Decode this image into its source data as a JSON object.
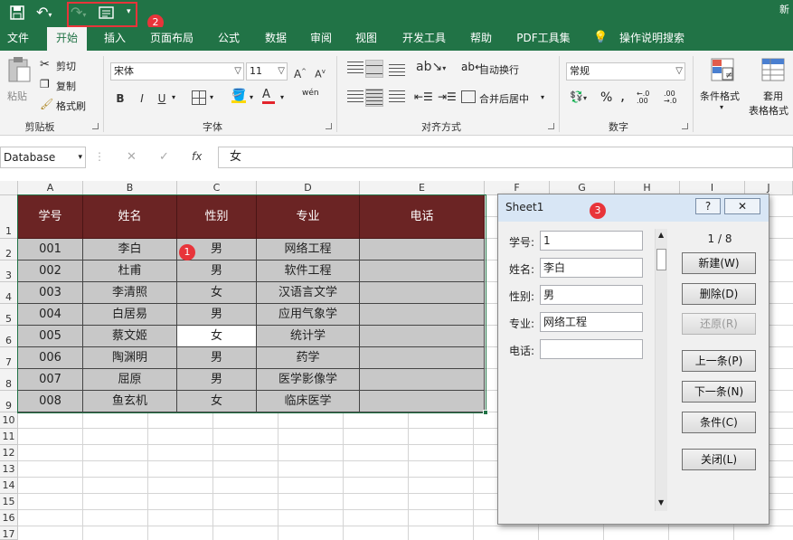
{
  "title_fragment": "新",
  "qat": {
    "step_badge": "2"
  },
  "tabs": [
    "文件",
    "开始",
    "插入",
    "页面布局",
    "公式",
    "数据",
    "审阅",
    "视图",
    "开发工具",
    "帮助",
    "PDF工具集",
    "操作说明搜索"
  ],
  "ribbon": {
    "clipboard": {
      "paste": "粘贴",
      "cut": "剪切",
      "copy": "复制",
      "format_painter": "格式刷",
      "group": "剪贴板"
    },
    "font": {
      "name": "宋体",
      "size": "11",
      "bold": "B",
      "italic": "I",
      "underline": "U",
      "grow": "A",
      "shrink": "A",
      "phonetic": "wén",
      "group": "字体"
    },
    "alignment": {
      "wrap": "自动换行",
      "merge": "合并后居中",
      "group": "对齐方式"
    },
    "number": {
      "format": "常规",
      "percent": "%",
      "comma": ",",
      "inc_dec": "←.0 .00",
      "dec_dec": ".00 →.0",
      "group": "数字"
    },
    "styles": {
      "conditional": "条件格式",
      "table_line1": "套用",
      "table_line2": "表格格式"
    }
  },
  "formula": {
    "name_box": "Database",
    "fx": "fx",
    "value": "女"
  },
  "columns": [
    "A",
    "B",
    "C",
    "D",
    "E",
    "F",
    "G",
    "H",
    "I",
    "J"
  ],
  "rows": [
    "1",
    "2",
    "3",
    "4",
    "5",
    "6",
    "7",
    "8",
    "9",
    "10",
    "11",
    "12",
    "13",
    "14",
    "15",
    "16",
    "17"
  ],
  "table": {
    "headers": [
      "学号",
      "姓名",
      "性别",
      "专业",
      "电话"
    ],
    "rows": [
      [
        "001",
        "李白",
        "男",
        "网络工程",
        ""
      ],
      [
        "002",
        "杜甫",
        "男",
        "软件工程",
        ""
      ],
      [
        "003",
        "李清照",
        "女",
        "汉语言文学",
        ""
      ],
      [
        "004",
        "白居易",
        "男",
        "应用气象学",
        ""
      ],
      [
        "005",
        "蔡文姬",
        "女",
        "统计学",
        ""
      ],
      [
        "006",
        "陶渊明",
        "男",
        "药学",
        ""
      ],
      [
        "007",
        "屈原",
        "男",
        "医学影像学",
        ""
      ],
      [
        "008",
        "鱼玄机",
        "女",
        "临床医学",
        ""
      ]
    ],
    "badge": "1"
  },
  "dialog": {
    "title": "Sheet1",
    "badge": "3",
    "help": "?",
    "close": "✕",
    "fields": [
      {
        "label": "学号:",
        "value": "1"
      },
      {
        "label": "姓名:",
        "value": "李白"
      },
      {
        "label": "性别:",
        "value": "男"
      },
      {
        "label": "专业:",
        "value": "网络工程"
      },
      {
        "label": "电话:",
        "value": ""
      }
    ],
    "record": "1 / 8",
    "buttons": [
      "新建(W)",
      "删除(D)",
      "还原(R)",
      "上一条(P)",
      "下一条(N)",
      "条件(C)",
      "关闭(L)"
    ]
  }
}
